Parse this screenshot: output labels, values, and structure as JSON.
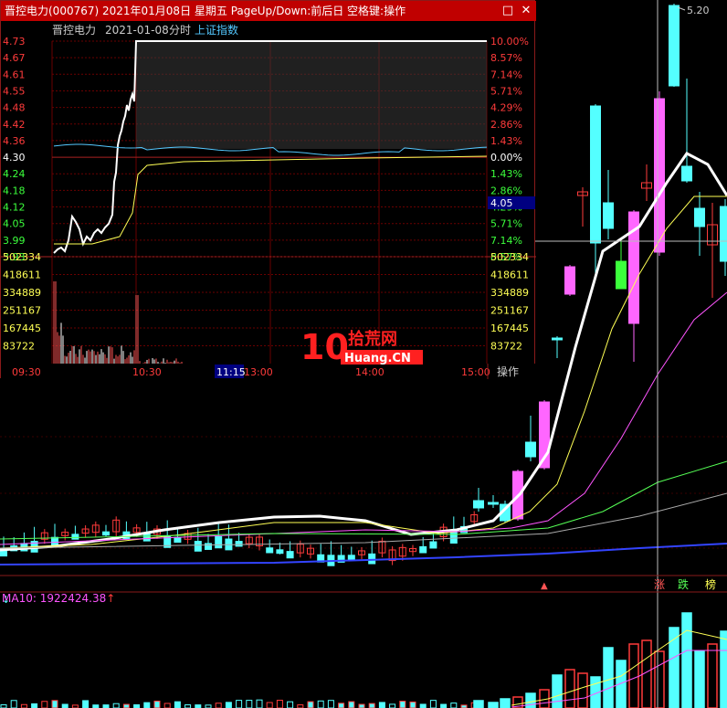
{
  "window": {
    "title": "晋控电力(000767) 2021年01月08日 星期五 PageUp/Down:前后日 空格键:操作",
    "stock_name": "晋控电力",
    "date": "2021-01-08",
    "mode": "分时",
    "index_label": "上证指数",
    "operate_button": "操作",
    "restore_icon": "restore-icon",
    "close_icon": "close-icon"
  },
  "price_axis": [
    "4.73",
    "4.67",
    "4.61",
    "4.55",
    "4.48",
    "4.42",
    "4.36",
    "4.30",
    "4.24",
    "4.18",
    "4.12",
    "4.05",
    "3.99",
    "3.93"
  ],
  "pct_axis": [
    "10.00%",
    "8.57%",
    "7.14%",
    "5.71%",
    "4.29%",
    "2.86%",
    "1.43%",
    "0.00%",
    "1.43%",
    "2.86%",
    "4.29%",
    "5.71%",
    "7.14%",
    "8.57%"
  ],
  "vol_axis": [
    "502334",
    "418611",
    "334889",
    "251167",
    "167445",
    "83722"
  ],
  "time_axis": [
    "09:30",
    "10:30",
    "11:15",
    "13:00",
    "14:00",
    "15:00"
  ],
  "cursor_price": "4.05",
  "kline": {
    "high_label": "5.20",
    "signals": [
      "涨",
      "跌",
      "榜"
    ],
    "ma10_label": "MA10: 1922424.38",
    "down_marker": "↓"
  },
  "watermark": {
    "number": "10",
    "cn": "拾荒网",
    "en": "Huang.CN"
  },
  "colors": {
    "up": "#ff3b3b",
    "down": "#54ffff",
    "limit": "#ff66ff",
    "title_bar": "#c00000",
    "price_green": "#3cff3c",
    "avg_line": "#ffff55"
  }
}
